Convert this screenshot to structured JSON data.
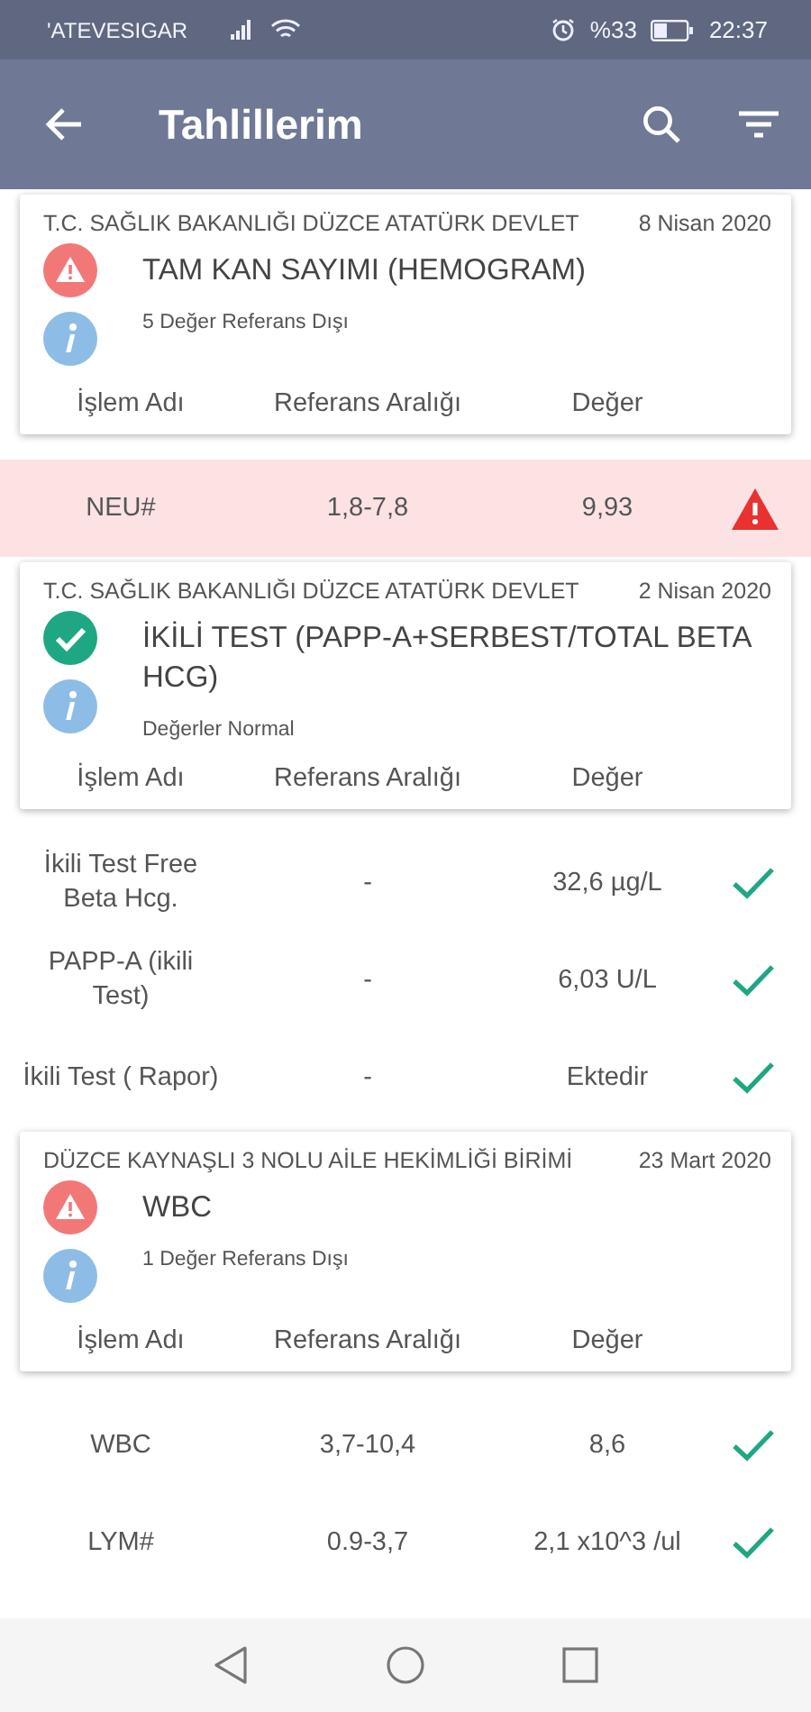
{
  "status_bar": {
    "carrier": "'ATEVESIGAR",
    "battery_text": "%33",
    "time": "22:37"
  },
  "app_bar": {
    "title": "Tahlillerim"
  },
  "sections": [
    {
      "institution": "T.C. SAĞLIK BAKANLIĞI DÜZCE ATATÜRK DEVLET",
      "date": "8 Nisan 2020",
      "out_of_range": true,
      "title": "TAM KAN SAYIMI (HEMOGRAM)",
      "summary": "5 Değer Referans Dışı",
      "columns": [
        "İşlem Adı",
        "Referans Aralığı",
        "Değer"
      ],
      "results": [
        {
          "name": "NEU#",
          "range": "1,8-7,8",
          "value": "9,93",
          "out_of_range": true
        }
      ]
    },
    {
      "institution": "T.C. SAĞLIK BAKANLIĞI DÜZCE ATATÜRK DEVLET",
      "date": "2 Nisan 2020",
      "out_of_range": false,
      "title": "İKİLİ TEST (PAPP-A+SERBEST/TOTAL BETA HCG)",
      "summary": "Değerler Normal",
      "columns": [
        "İşlem Adı",
        "Referans Aralığı",
        "Değer"
      ],
      "results": [
        {
          "name": "İkili Test Free Beta Hcg.",
          "range": "-",
          "value": "32,6 µg/L",
          "out_of_range": false
        },
        {
          "name": "PAPP-A (ikili Test)",
          "range": "-",
          "value": "6,03 U/L",
          "out_of_range": false
        },
        {
          "name": "İkili Test ( Rapor)",
          "range": "-",
          "value": "Ektedir",
          "out_of_range": false
        }
      ]
    },
    {
      "institution": "DÜZCE KAYNAŞLI 3 NOLU AİLE HEKİMLİĞİ BİRİMİ",
      "date": "23 Mart 2020",
      "out_of_range": true,
      "title": "WBC",
      "summary": "1 Değer Referans Dışı",
      "columns": [
        "İşlem Adı",
        "Referans Aralığı",
        "Değer"
      ],
      "results": [
        {
          "name": "WBC",
          "range": "3,7-10,4",
          "value": "8,6",
          "out_of_range": false
        },
        {
          "name": "LYM#",
          "range": "0.9-3,7",
          "value": "2,1 x10^3 /ul",
          "out_of_range": false
        }
      ]
    }
  ]
}
